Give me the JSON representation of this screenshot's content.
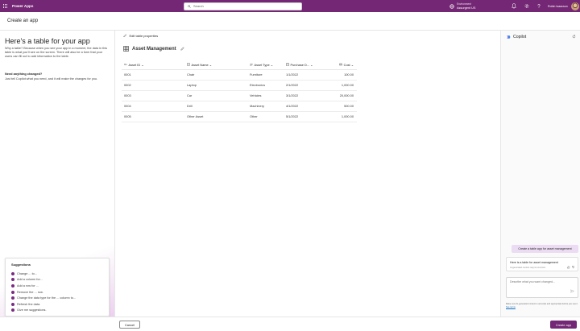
{
  "topbar": {
    "app_name": "Power Apps",
    "search_placeholder": "Search",
    "environment_label": "Environment",
    "environment_value": "Assurgent US",
    "user_name": "Robin Isaacson"
  },
  "header": {
    "title": "Create an app"
  },
  "left": {
    "heading": "Here's a table for your app",
    "intro": "Why a table? Because when you see your app in a moment, the data in this table is what you'll see on the screen. There will also be a form that your users can fill out to add information to the table.",
    "subheading": "Need anything changed?",
    "subtext": "Just tell Copilot what you need, and it will make the changes for you.",
    "suggestions_title": "Suggestions",
    "suggestions": [
      "Change ... to...",
      "Add a column for...",
      "Add a row for ...",
      "Remove the ... row.",
      "Change the data type for the ... column to...",
      "Refresh the data.",
      "Give me suggestions."
    ]
  },
  "main": {
    "edit_label": "Edit table properties",
    "table_name": "Asset Management",
    "columns": [
      "Asset ID",
      "Asset Name",
      "Asset Type",
      "Purchase D...",
      "Cost"
    ],
    "rows": [
      [
        "0001",
        "Chair",
        "Furniture",
        "1/1/2022",
        "100.00"
      ],
      [
        "0002",
        "Laptop",
        "Electronics",
        "2/1/2022",
        "1,000.00"
      ],
      [
        "0003",
        "Car",
        "Vehicles",
        "3/1/2022",
        "20,000.00"
      ],
      [
        "0004",
        "Drill",
        "Machinery",
        "4/1/2022",
        "500.00"
      ],
      [
        "0005",
        "Other Asset",
        "Other",
        "5/1/2022",
        "1,000.00"
      ]
    ]
  },
  "copilot": {
    "title": "Copilot",
    "user_message": "Create a table app for asset management",
    "bot_message": "Here is a table for asset management",
    "bot_meta": "AI-generated content may be incorrect",
    "input_placeholder": "Describe what you want changed...",
    "disclaimer": "Make sure AI-generated content is accurate and appropriate before you use it.",
    "terms_link": "See terms"
  },
  "footer": {
    "cancel_label": "Cancel",
    "create_label": "Create app"
  },
  "colors": {
    "brand": "#742774",
    "copilot_bubble": "#ecdcf3",
    "suggestion_dot": "#7a2a82"
  }
}
